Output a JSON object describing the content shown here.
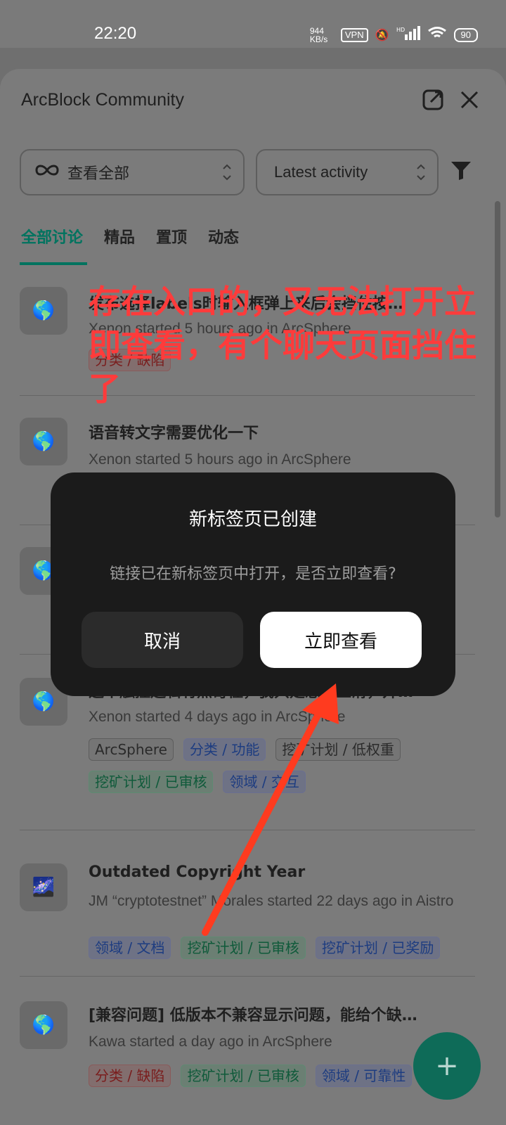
{
  "status_bar": {
    "time": "22:20",
    "net_speed": "944 KB/s",
    "vpn": "VPN",
    "network": "HD",
    "battery": "90"
  },
  "sheet": {
    "title": "ArcBlock Community",
    "filters": {
      "category": "查看全部",
      "sort": "Latest activity"
    },
    "tabs": [
      "全部讨论",
      "精品",
      "置顶",
      "动态"
    ]
  },
  "items": [
    {
      "title": "发布选择labels时输入框弹上来后会挡住按…",
      "meta": "Xenon started 5 hours ago in ArcSphere",
      "tags": [
        {
          "text": "分类 / 缺陷",
          "style": "red"
        }
      ]
    },
    {
      "title": "语音转文字需要优化一下",
      "meta": "Xenon started 5 hours ago in ArcSphere",
      "tags": []
    },
    {
      "title": "这个触控逻辑有点奇怪，我只是想向上滑，开…",
      "meta": "Xenon started 4 days ago in ArcSphere",
      "tags": [
        {
          "text": "ArcSphere",
          "style": "gray"
        },
        {
          "text": "分类 / 功能",
          "style": "blue"
        },
        {
          "text": "挖矿计划 / 低权重",
          "style": "gray"
        },
        {
          "text": "挖矿计划 / 已审核",
          "style": "green"
        },
        {
          "text": "领域 / 交互",
          "style": "blue"
        }
      ]
    },
    {
      "title": "Outdated Copyright Year",
      "meta": "JM “cryptotestnet” Morales started 22 days ago in Aistro",
      "tags": [
        {
          "text": "领域 / 文档",
          "style": "blue"
        },
        {
          "text": "挖矿计划 / 已审核",
          "style": "green"
        },
        {
          "text": "挖矿计划 / 已奖励",
          "style": "blue"
        }
      ]
    },
    {
      "title": "[兼容问题] 低版本不兼容显示问题，能给个缺…",
      "meta": "Kawa started a day ago in ArcSphere",
      "tags": [
        {
          "text": "分类 / 缺陷",
          "style": "red"
        },
        {
          "text": "挖矿计划 / 已审核",
          "style": "green"
        },
        {
          "text": "领域 / 可靠性",
          "style": "blue"
        }
      ]
    }
  ],
  "annotation": "存在入口的，又无法打开立即查看，有个聊天页面挡住了",
  "dialog": {
    "title": "新标签页已创建",
    "message": "链接已在新标签页中打开，是否立即查看?",
    "cancel": "取消",
    "confirm": "立即查看"
  },
  "fab": "+"
}
